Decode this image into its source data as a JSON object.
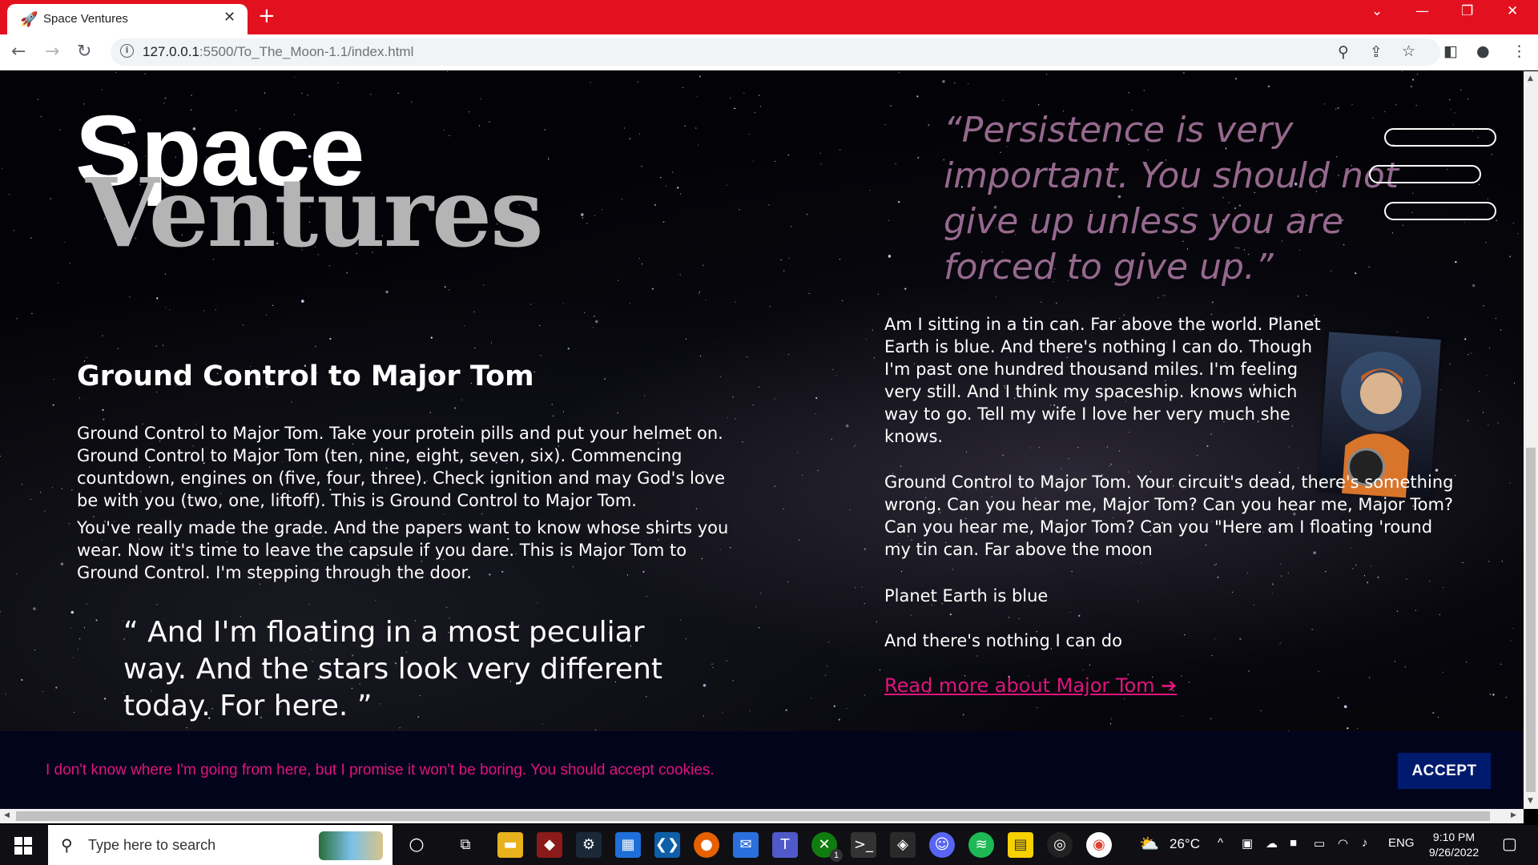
{
  "browser": {
    "tab_title": "Space Ventures",
    "new_tab_label": "+",
    "url_host": "127.0.0.1",
    "url_rest": ":5500/To_The_Moon-1.1/index.html"
  },
  "page": {
    "logo_line1": "Space",
    "logo_line2": "Ventures",
    "top_quote": "“Persistence is very important. You should not give up unless you are forced to give up.”",
    "heading": "Ground Control to Major Tom",
    "left_paragraphs": [
      "Ground Control to Major Tom. Take your protein pills and put your helmet on. Ground Control to Major Tom (ten, nine, eight, seven, six). Commencing countdown, engines on (five, four, three). Check ignition and may God's love be with you (two, one, liftoff). This is Ground Control to Major Tom.",
      "You've really made the grade. And the papers want to know whose shirts you wear. Now it's time to leave the capsule if you dare. This is Major Tom to Ground Control. I'm stepping through the door."
    ],
    "bottom_quote": "“ And I'm floating in a most peculiar way. And the stars look very different today. For here. ”",
    "right_paragraphs": [
      "Am I sitting in a tin can. Far above the world. Planet Earth is blue. And there's nothing I can do. Though I'm past one hundred thousand miles. I'm feeling very still. And I think my spaceship. knows which way to go. Tell my wife I love her very much she knows.",
      "Ground Control to Major Tom. Your circuit's dead, there's something wrong. Can you hear me, Major Tom? Can you hear me, Major Tom? Can you hear me, Major Tom? Can you \"Here am I floating 'round my tin can. Far above the moon",
      "Planet Earth is blue",
      "And there's nothing I can do"
    ],
    "read_more": "Read more about Major Tom ➔",
    "cookie_text": "I don't know where I'm going from here, but I promise it won't be boring. You should accept cookies.",
    "accept_label": "ACCEPT"
  },
  "taskbar": {
    "search_placeholder": "Type here to search",
    "temperature": "26°C",
    "language": "ENG",
    "time": "9:10 PM",
    "date": "9/26/2022",
    "chat_badge": "1"
  },
  "colors": {
    "tab_bar": "#e3111f",
    "accent_pink": "#e0147d",
    "accept_bg": "#001a6e",
    "cookie_bg": "#02041c"
  }
}
